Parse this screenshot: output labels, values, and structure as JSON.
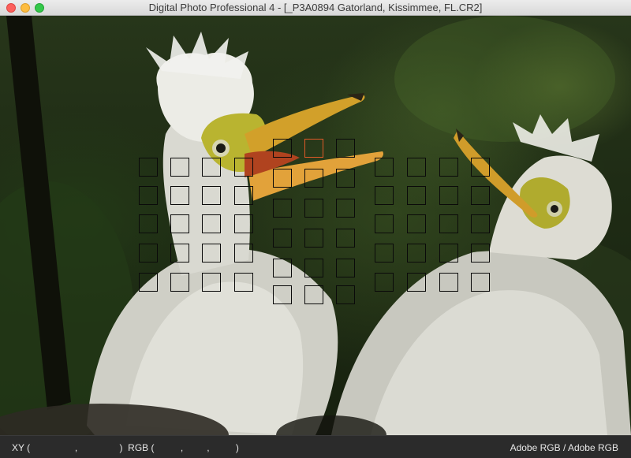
{
  "window": {
    "title": "Digital Photo Professional 4 - [_P3A0894 Gatorland, Kissimmee, FL.CR2]"
  },
  "status_bar": {
    "xy_label": "XY (",
    "xy_sep1": ",",
    "xy_close": ")",
    "rgb_label": "RGB (",
    "rgb_sep1": ",",
    "rgb_sep2": ",",
    "rgb_close": ")",
    "color_space": "Adobe RGB / Adobe RGB"
  },
  "af_overlay": {
    "rows": 5,
    "cols": 11,
    "center_columns_extra_row": true,
    "selected_point": {
      "row": 0,
      "col": 5
    },
    "selected_color": "#e05a28"
  },
  "colors": {
    "titlebar": "#e2e2e2",
    "statusbar": "#2b2b2b",
    "af_frame": "#0a0a0a"
  }
}
